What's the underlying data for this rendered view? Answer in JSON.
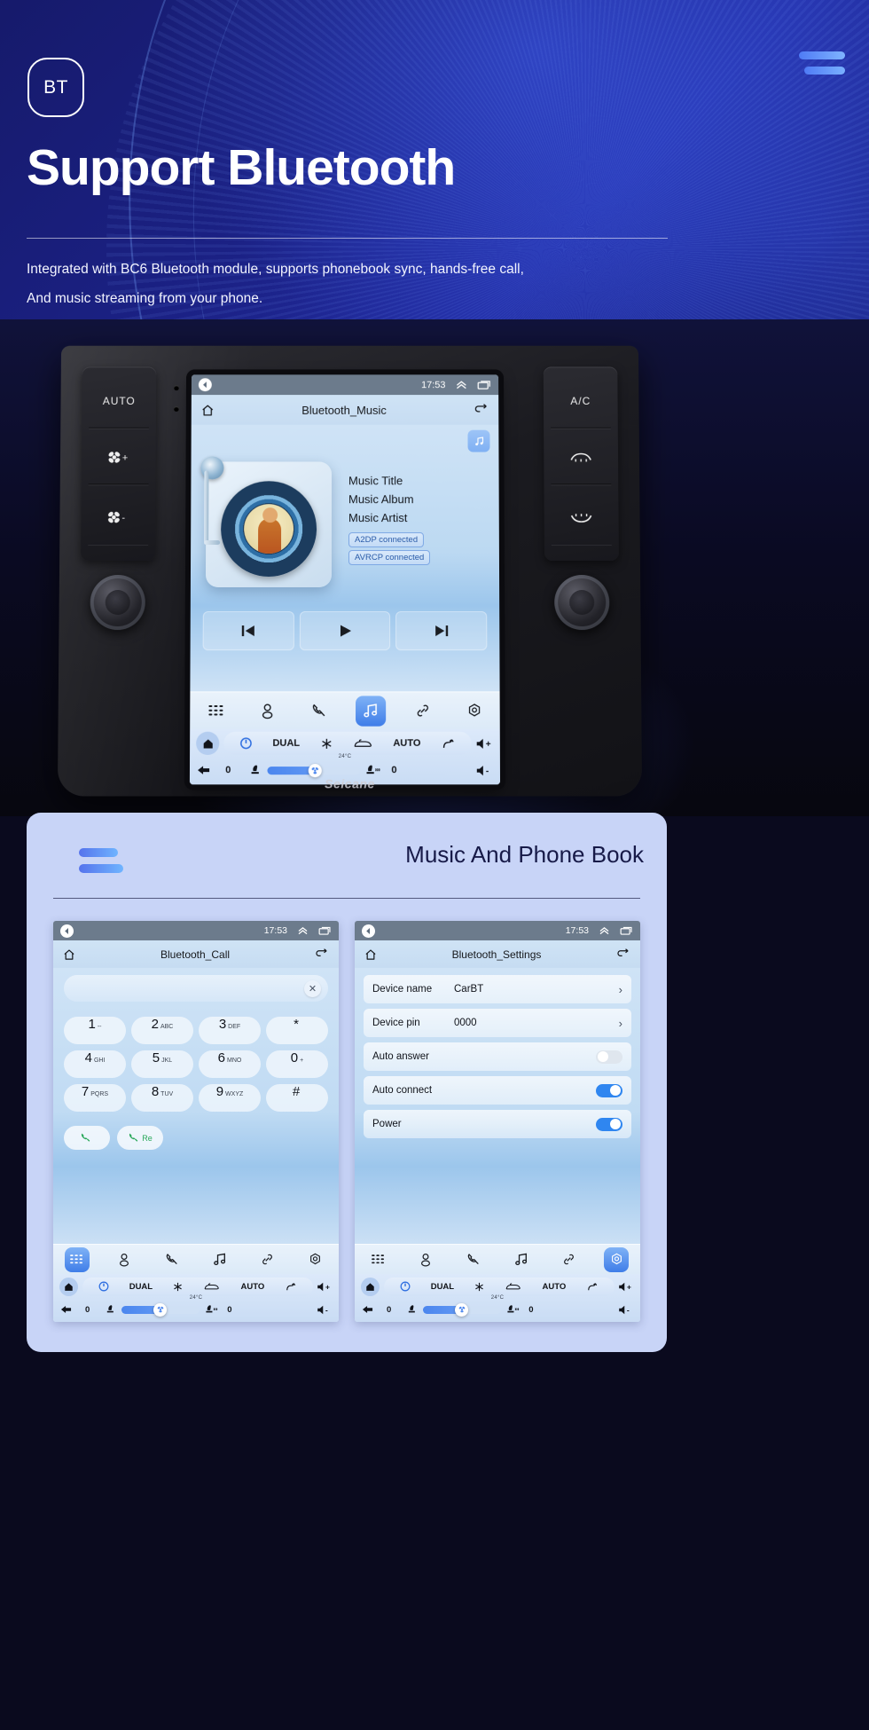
{
  "hero": {
    "badge": "BT",
    "title": "Support Bluetooth",
    "line1": "Integrated with BC6 Bluetooth module, supports phonebook sync, hands-free call,",
    "line2": "And music streaming from your phone.",
    "menu_icon": "hamburger-icon"
  },
  "stereo": {
    "brand": "Seicane",
    "left_buttons": [
      "AUTO",
      "fan-plus",
      "fan-minus"
    ],
    "right_buttons": [
      "A/C",
      "front-defrost",
      "rear-defrost"
    ],
    "screen": {
      "status": {
        "time": "17:53",
        "back_icon": "back-circle-icon",
        "up_icon": "chevron-up-icon",
        "recents_icon": "recents-icon"
      },
      "app": {
        "home_icon": "home-icon",
        "title": "Bluetooth_Music",
        "back_icon": "return-icon"
      },
      "player": {
        "source_icon": "music-note-icon",
        "title": "Music Title",
        "album": "Music Album",
        "artist": "Music Artist",
        "tags": [
          "A2DP  connected",
          "AVRCP connected"
        ],
        "transport": [
          "prev-icon",
          "play-icon",
          "next-icon"
        ]
      },
      "nav": [
        {
          "name": "keypad-icon",
          "active": false
        },
        {
          "name": "contacts-icon",
          "active": false
        },
        {
          "name": "phone-icon",
          "active": false
        },
        {
          "name": "music-icon",
          "active": true
        },
        {
          "name": "link-icon",
          "active": false
        },
        {
          "name": "settings-icon",
          "active": false
        }
      ],
      "climate": {
        "home_icon": "home-icon",
        "power_icon": "power-icon",
        "dual": "DUAL",
        "snow_icon": "snowflake-icon",
        "defrost_icon": "defrost-icon",
        "auto": "AUTO",
        "recirc_icon": "recirculate-icon",
        "vol_up_icon": "volume-up-icon",
        "temp": "24°C",
        "back_icon": "back-arrow-icon",
        "left_value": "0",
        "right_value": "0",
        "seat_icon": "seat-icon",
        "seat_heat_icon": "seat-heat-icon",
        "vol_down_icon": "volume-down-icon"
      }
    }
  },
  "card": {
    "title": "Music And Phone Book",
    "menu_icon": "hamburger-icon",
    "call_pane": {
      "status": {
        "time": "17:53",
        "back_icon": "back-circle-icon",
        "up_icon": "chevron-up-icon",
        "recents_icon": "recents-icon"
      },
      "app": {
        "home_icon": "home-icon",
        "title": "Bluetooth_Call",
        "back_icon": "return-icon"
      },
      "input_value": "",
      "clear_icon": "close-icon",
      "keys": [
        {
          "digit": "1",
          "letters": "--"
        },
        {
          "digit": "2",
          "letters": "ABC"
        },
        {
          "digit": "3",
          "letters": "DEF"
        },
        {
          "digit": "*",
          "letters": ""
        },
        {
          "digit": "4",
          "letters": "GHI"
        },
        {
          "digit": "5",
          "letters": "JKL"
        },
        {
          "digit": "6",
          "letters": "MNO"
        },
        {
          "digit": "0",
          "letters": "+"
        },
        {
          "digit": "7",
          "letters": "PQRS"
        },
        {
          "digit": "8",
          "letters": "TUV"
        },
        {
          "digit": "9",
          "letters": "WXYZ"
        },
        {
          "digit": "#",
          "letters": ""
        }
      ],
      "call_button": {
        "icon": "call-icon",
        "label": ""
      },
      "redial_button": {
        "icon": "call-icon",
        "label": "Re"
      },
      "nav": [
        {
          "name": "keypad-icon",
          "active": true
        },
        {
          "name": "contacts-icon",
          "active": false
        },
        {
          "name": "phone-icon",
          "active": false
        },
        {
          "name": "music-icon",
          "active": false
        },
        {
          "name": "link-icon",
          "active": false
        },
        {
          "name": "settings-icon",
          "active": false
        }
      ]
    },
    "settings_pane": {
      "status": {
        "time": "17:53",
        "back_icon": "back-circle-icon",
        "up_icon": "chevron-up-icon",
        "recents_icon": "recents-icon"
      },
      "app": {
        "home_icon": "home-icon",
        "title": "Bluetooth_Settings",
        "back_icon": "return-icon"
      },
      "rows": [
        {
          "label": "Device name",
          "value": "CarBT",
          "control": "chevron"
        },
        {
          "label": "Device pin",
          "value": "0000",
          "control": "chevron"
        },
        {
          "label": "Auto answer",
          "value": "",
          "control": "toggle-off"
        },
        {
          "label": "Auto connect",
          "value": "",
          "control": "toggle-on"
        },
        {
          "label": "Power",
          "value": "",
          "control": "toggle-on"
        }
      ],
      "nav": [
        {
          "name": "keypad-icon",
          "active": false
        },
        {
          "name": "contacts-icon",
          "active": false
        },
        {
          "name": "phone-icon",
          "active": false
        },
        {
          "name": "music-icon",
          "active": false
        },
        {
          "name": "link-icon",
          "active": false
        },
        {
          "name": "settings-icon",
          "active": true
        }
      ]
    },
    "climate": {
      "dual": "DUAL",
      "auto": "AUTO",
      "temp": "24°C",
      "left_value": "0",
      "right_value": "0"
    }
  },
  "colors": {
    "hero_bg": "#1b2185",
    "accent_blue": "#4f7bf5",
    "card_bg": "#c8d4f7",
    "screen_bg": "#cfe2f3",
    "status_bar": "#6c7b8c",
    "active_nav": "#3f7de8",
    "toggle_on": "#2f86f0",
    "call_green": "#2aa85a"
  }
}
